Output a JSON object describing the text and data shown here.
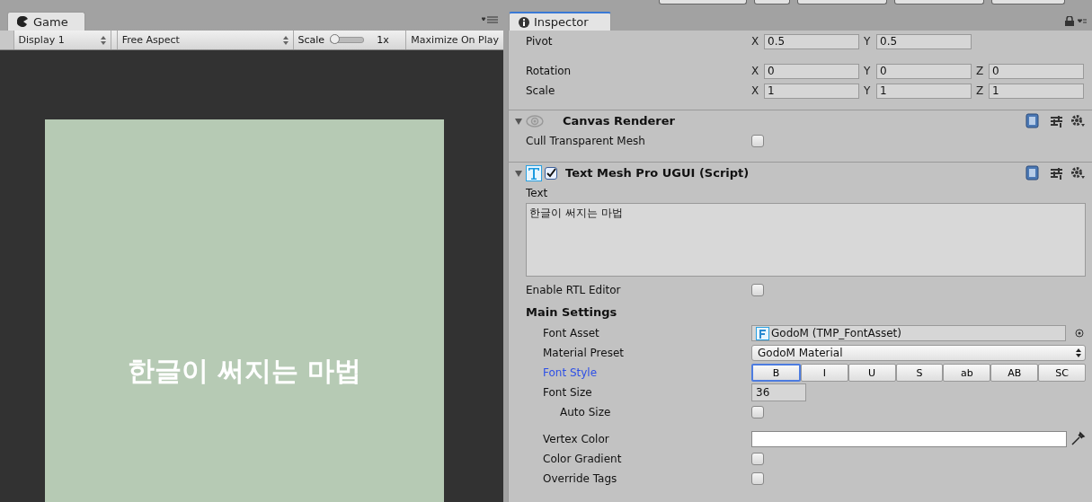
{
  "game_panel": {
    "tab": "Game",
    "toolbar": {
      "display": "Display 1",
      "aspect": "Free Aspect",
      "scale_label": "Scale",
      "scale_slider": {
        "level": 0
      },
      "scale_value": "1x",
      "maximize": "Maximize On Play"
    },
    "viewport_text": "한글이 써지는 마법"
  },
  "inspector": {
    "tab": "Inspector",
    "transform_rows": [
      {
        "label": "Pivot",
        "fields": [
          {
            "axis": "X",
            "value": "0.5"
          },
          {
            "axis": "Y",
            "value": "0.5"
          }
        ]
      },
      {
        "label": "Rotation",
        "fields": [
          {
            "axis": "X",
            "value": "0"
          },
          {
            "axis": "Y",
            "value": "0"
          },
          {
            "axis": "Z",
            "value": "0"
          }
        ]
      },
      {
        "label": "Scale",
        "fields": [
          {
            "axis": "X",
            "value": "1"
          },
          {
            "axis": "Y",
            "value": "1"
          },
          {
            "axis": "Z",
            "value": "1"
          }
        ]
      }
    ],
    "components": [
      {
        "kind": "eye",
        "title": "Canvas Renderer",
        "rows": [
          {
            "kind": "checkbox",
            "label": "Cull Transparent Mesh",
            "checked": false
          }
        ]
      },
      {
        "kind": "script",
        "title": "Text Mesh Pro UGUI (Script)",
        "checked": true,
        "rows": [
          {
            "kind": "label",
            "label": "Text"
          },
          {
            "kind": "textarea",
            "value": "한글이 써지는 마법"
          },
          {
            "kind": "checkbox",
            "label": "Enable RTL Editor",
            "checked": false
          },
          {
            "kind": "heading",
            "label": "Main Settings",
            "children": [
              {
                "kind": "object",
                "label": "Font Asset",
                "value": "GodoM (TMP_FontAsset)"
              },
              {
                "kind": "dropdown",
                "label": "Material Preset",
                "value": "GodoM Material"
              },
              {
                "kind": "toggles",
                "label": "Font Style",
                "focused": true,
                "options": [
                  {
                    "label": "B",
                    "focused": true
                  },
                  {
                    "label": "I",
                    "focused": false
                  },
                  {
                    "label": "U",
                    "focused": false
                  },
                  {
                    "label": "S",
                    "focused": false
                  },
                  {
                    "label": "ab",
                    "focused": false
                  },
                  {
                    "label": "AB",
                    "focused": false
                  },
                  {
                    "label": "SC",
                    "focused": false
                  }
                ]
              },
              {
                "kind": "number",
                "label": "Font Size",
                "value": "36",
                "children": [
                  {
                    "kind": "checkbox",
                    "label": "Auto Size",
                    "checked": false
                  }
                ]
              },
              {
                "kind": "color",
                "label": "Vertex Color",
                "color": "#ffffff"
              },
              {
                "kind": "checkbox",
                "label": "Color Gradient",
                "checked": false
              },
              {
                "kind": "checkbox",
                "label": "Override Tags",
                "checked": false
              }
            ]
          }
        ]
      }
    ]
  }
}
